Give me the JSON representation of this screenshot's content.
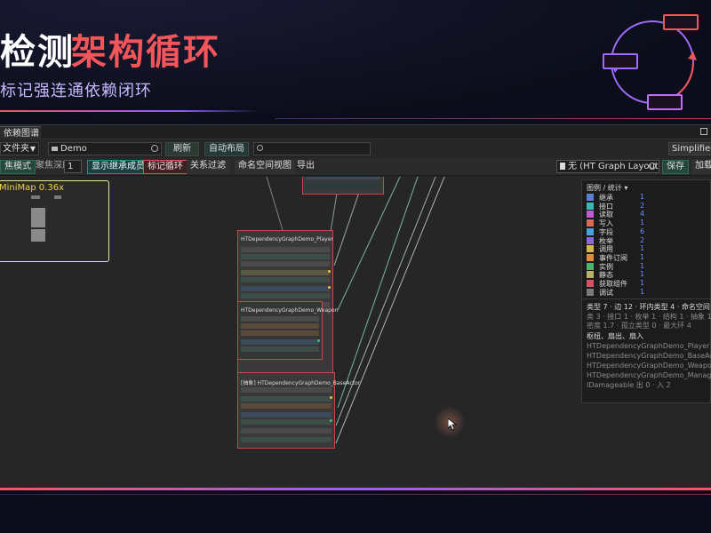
{
  "banner": {
    "title_white": "检测",
    "title_red": "架构循环",
    "subtitle": "标记强连通依赖闭环"
  },
  "window": {
    "tab_label": "依赖图谱"
  },
  "toolbar1": {
    "scope_select": "文件夹",
    "path_value": "Demo",
    "refresh_label": "刷新",
    "auto_layout_label": "自动布局",
    "search_placeholder": "",
    "simplified_label": "Simplified C"
  },
  "toolbar2": {
    "focus_mode_label": "焦模式",
    "depth_label": "聚焦深度",
    "depth_value": "1",
    "show_inherit_label": "显示继承成员",
    "mark_cycle_label": "标记循环",
    "relation_filter_label": "关系过滤",
    "namespace_view_label": "命名空间视图",
    "export_label": "导出",
    "layout_preset_value": "无 (HT Graph Layout Pres",
    "save_label": "保存",
    "load_label": "加载"
  },
  "minimap": {
    "title": "MiniMap  0.36x"
  },
  "nodes": [
    {
      "title": "HTDependencyGraphDemo_Player"
    },
    {
      "title": "HTDependencyGraphDemo_Weapon"
    },
    {
      "title": "[抽象] HTDependencyGraphDemo_BaseActor"
    }
  ],
  "legend": {
    "title": "图例 / 统计 ▾",
    "items": [
      {
        "name": "继承",
        "count": "1",
        "color": "#5b7fd6"
      },
      {
        "name": "接口",
        "count": "2",
        "color": "#39b7b0"
      },
      {
        "name": "读取",
        "count": "4",
        "color": "#c25bd6"
      },
      {
        "name": "写入",
        "count": "1",
        "color": "#d66a5b"
      },
      {
        "name": "字段",
        "count": "6",
        "color": "#4aa3df"
      },
      {
        "name": "枚举",
        "count": "2",
        "color": "#8a6bd6"
      },
      {
        "name": "调用",
        "count": "1",
        "color": "#d6b84a"
      },
      {
        "name": "事件订阅",
        "count": "1",
        "color": "#e08a3a"
      },
      {
        "name": "实例",
        "count": "1",
        "color": "#49b86a"
      },
      {
        "name": "静态",
        "count": "1",
        "color": "#b8b26a"
      },
      {
        "name": "获取组件",
        "count": "1",
        "color": "#d6506a"
      },
      {
        "name": "调试",
        "count": "1",
        "color": "#7a7a7a"
      }
    ],
    "summary": "类型 7 · 边 12 · 环内类型 4 · 命名空间 1",
    "stats1": "类 3 · 接口 1 · 枚举 1 · 结构 1 · 抽象 1 · 静态 0",
    "stats2": "密度 1.7 · 孤立类型 0 · 最大环 4",
    "hub_title": "枢纽、扇出、扇入",
    "hubs": [
      "HTDependencyGraphDemo_Player  出 5 · 入 2",
      "HTDependencyGraphDemo_BaseActor  出 4 · 入 1",
      "HTDependencyGraphDemo_Weapon  出 2 · 入 2",
      "HTDependencyGraphDemo_Manager  出 1 · 入 2",
      "IDamageable  出 0 · 入 2"
    ]
  }
}
